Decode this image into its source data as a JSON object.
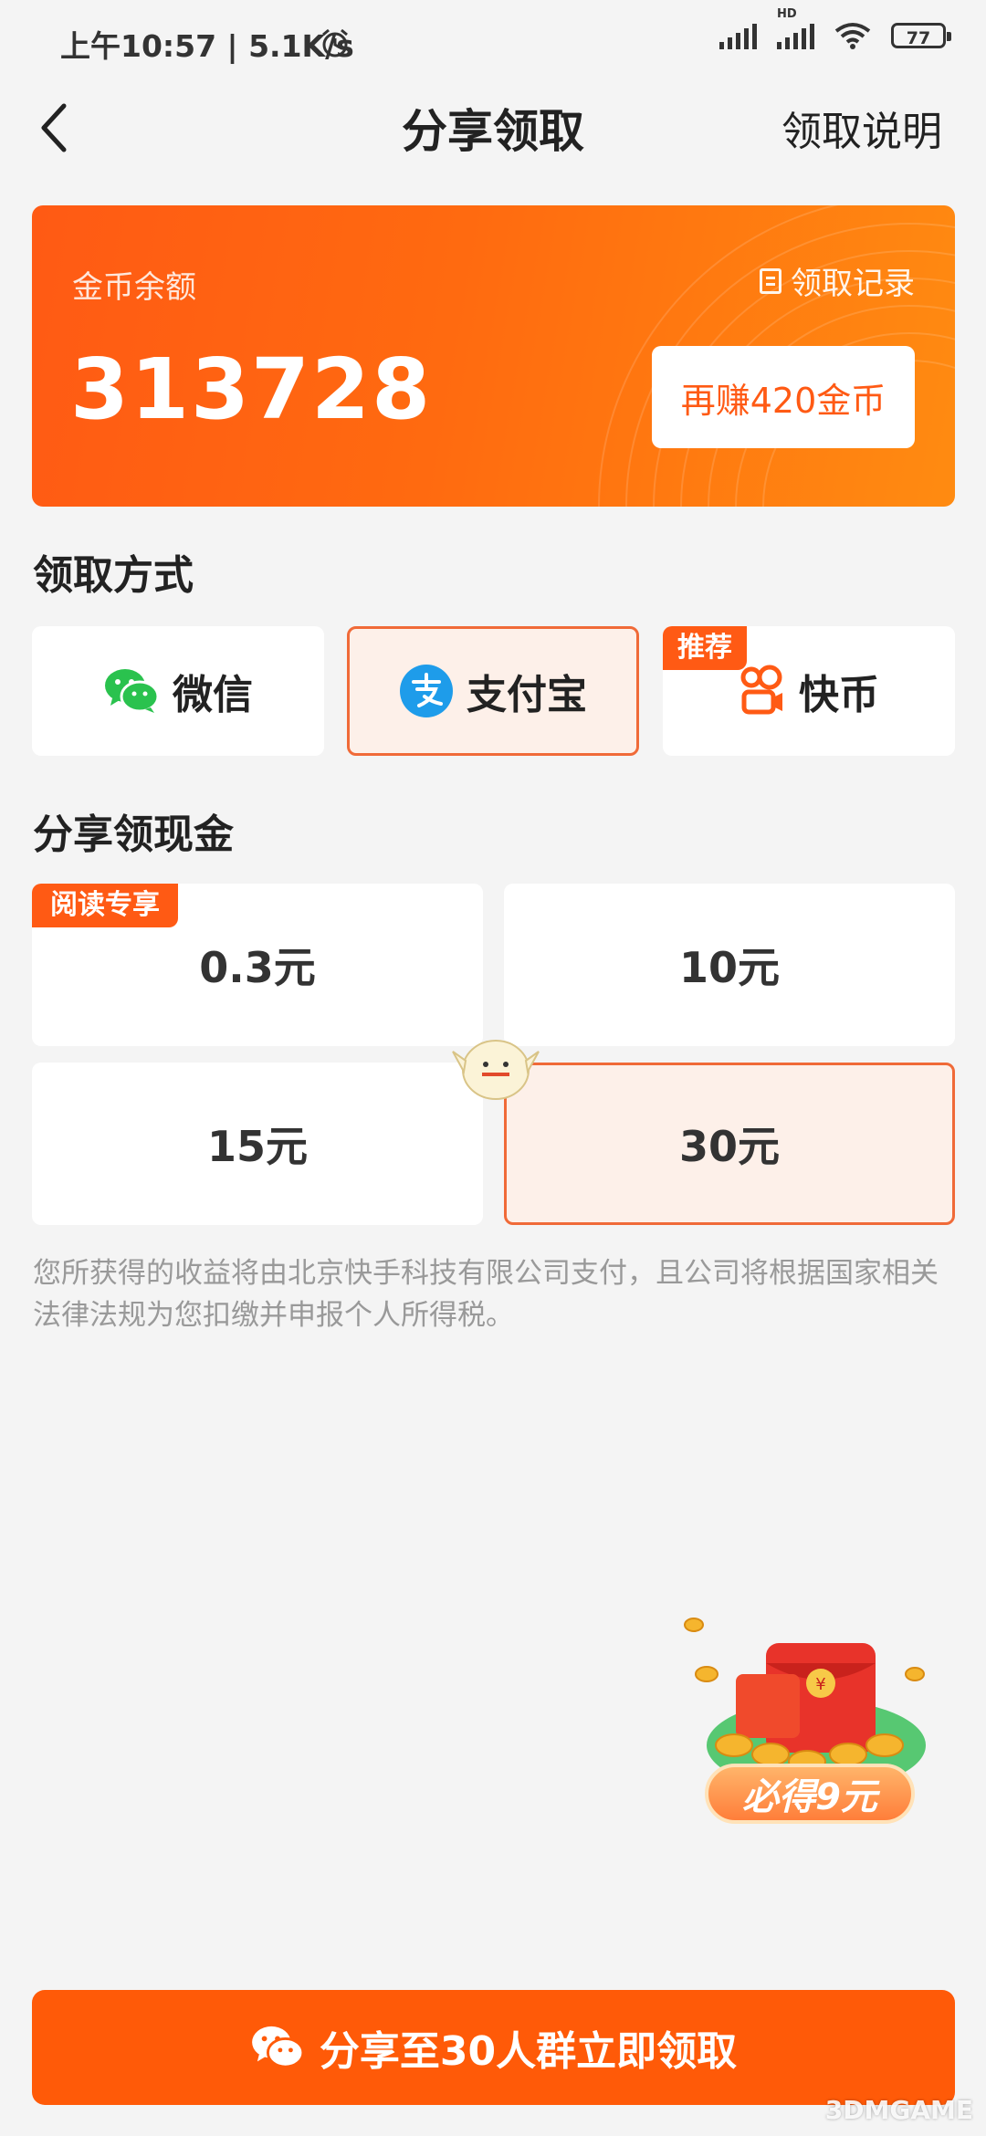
{
  "status_bar": {
    "time": "上午10:57 | 5.1K/s",
    "network_badge": "HD",
    "battery": "77"
  },
  "header": {
    "back_icon": "chevron-left-icon",
    "title": "分享领取",
    "help_link": "领取说明"
  },
  "balance_card": {
    "label": "金币余额",
    "record_link": "领取记录",
    "balance": "313728",
    "earn_button": "再赚420金币",
    "gradient_colors": [
      "#ff5a14",
      "#ff8b11"
    ]
  },
  "method_section": {
    "title": "领取方式",
    "options": [
      {
        "label": "微信",
        "icon": "wechat-icon",
        "selected": false
      },
      {
        "label": "支付宝",
        "icon": "alipay-icon",
        "selected": true
      },
      {
        "label": "快币",
        "icon": "kuaishou-icon",
        "selected": false,
        "tag": "推荐"
      }
    ]
  },
  "cash_section": {
    "title": "分享领现金",
    "amounts": [
      {
        "label": "0.3元",
        "tag": "阅读专享",
        "selected": false
      },
      {
        "label": "10元",
        "selected": false
      },
      {
        "label": "15元",
        "selected": false
      },
      {
        "label": "30元",
        "selected": true
      }
    ]
  },
  "notice": "您所获得的收益将由北京快手科技有限公司支付，且公司将根据国家相关法律法规为您扣缴并申报个人所得税。",
  "promo": {
    "icon": "red-envelope-coins-icon",
    "badge": "必得9元"
  },
  "cta": {
    "icon": "wechat-icon",
    "label": "分享至30人群立即领取"
  },
  "watermark": "3DMGAME",
  "colors": {
    "accent": "#ff5a08",
    "selected_bg": "#fdf0e9",
    "selected_border": "#f06a38",
    "page_bg": "#f4f4f4"
  }
}
